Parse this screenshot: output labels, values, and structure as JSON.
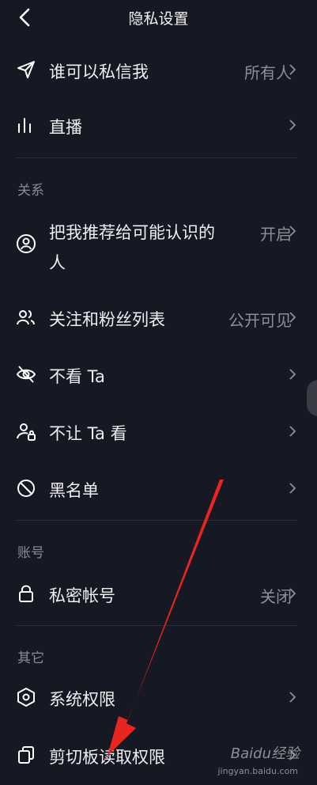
{
  "header": {
    "title": "隐私设置"
  },
  "rows": [
    {
      "label": "谁可以私信我",
      "value": "所有人"
    },
    {
      "label": "直播",
      "value": ""
    },
    {
      "label": "把我推荐给可能认识的",
      "label2": "人",
      "value": "开启"
    },
    {
      "label": "关注和粉丝列表",
      "value": "公开可见"
    },
    {
      "label": "不看 Ta",
      "value": ""
    },
    {
      "label": "不让 Ta 看",
      "value": ""
    },
    {
      "label": "黑名单",
      "value": ""
    },
    {
      "label": "私密帐号",
      "value": "关闭"
    },
    {
      "label": "系统权限",
      "value": ""
    },
    {
      "label": "剪切板读取权限",
      "value": ""
    }
  ],
  "sections": {
    "relations": "关系",
    "account": "账号",
    "other": "其它"
  },
  "watermark": {
    "text": "Baidu经验",
    "sub": "jingyan.baidu.com"
  },
  "colors": {
    "background": "#161823",
    "arrow": "#e8261f"
  }
}
